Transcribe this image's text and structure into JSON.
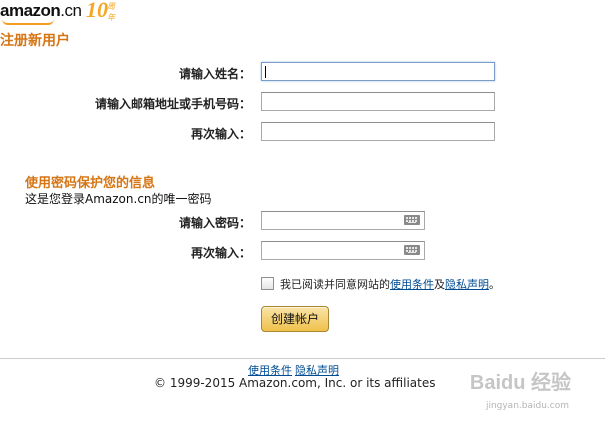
{
  "logo": {
    "brand": "amazon",
    "suffix": ".cn",
    "anniversary_mark": "10",
    "anniversary_label": "周年"
  },
  "page_title": "注册新用户",
  "name_form": {
    "name_label": "请输入姓名：",
    "name_value": "",
    "email_label": "请输入邮箱地址或手机号码：",
    "email_value": "",
    "confirm_label": "再次输入：",
    "confirm_value": ""
  },
  "password_section": {
    "title": "使用密码保护您的信息",
    "subtitle": "这是您登录Amazon.cn的唯一密码",
    "password_label": "请输入密码：",
    "password_value": "",
    "confirm_label": "再次输入：",
    "confirm_value": ""
  },
  "agreement": {
    "prefix": "我已阅读并同意网站的",
    "terms_link": "使用条件",
    "conjunction": "及",
    "privacy_link": "隐私声明",
    "suffix": "。",
    "checked": false
  },
  "create_button_label": "创建帐户",
  "footer": {
    "terms_link": "使用条件",
    "privacy_link": "隐私声明",
    "copyright": "© 1999-2015 Amazon.com, Inc. or its affiliates"
  },
  "watermark": {
    "text": "Baidu 经验",
    "url": "jingyan.baidu.com"
  },
  "colors": {
    "accent_orange": "#d57514",
    "link_blue": "#004b91",
    "button_gold": "#f0c14b"
  }
}
